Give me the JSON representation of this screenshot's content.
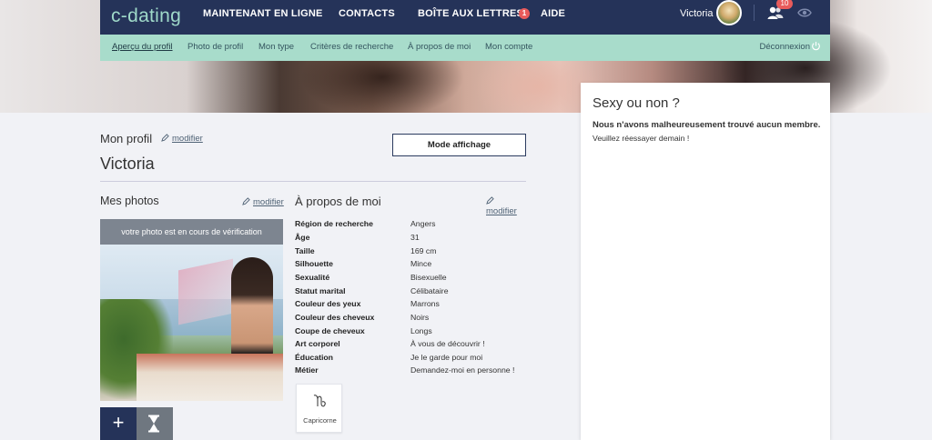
{
  "brand": {
    "logo": "c-dating"
  },
  "topnav": {
    "items": [
      {
        "label": "MAINTENANT EN LIGNE"
      },
      {
        "label": "CONTACTS"
      },
      {
        "label": "BOÎTE AUX LETTRES",
        "badge": "1"
      },
      {
        "label": "AIDE"
      }
    ],
    "user_name": "Victoria",
    "contacts_badge": "10"
  },
  "subnav": {
    "items": [
      {
        "label": "Aperçu du profil",
        "active": true
      },
      {
        "label": "Photo de profil"
      },
      {
        "label": "Mon type"
      },
      {
        "label": "Critères de recherche"
      },
      {
        "label": "À propos de moi"
      },
      {
        "label": "Mon compte"
      }
    ],
    "logout": "Déconnexion"
  },
  "profile": {
    "section_label": "Mon profil",
    "modify_label": "modifier",
    "name": "Victoria",
    "mode_button": "Mode affichage"
  },
  "photos": {
    "title": "Mes photos",
    "modify_label": "modifier",
    "verification_notice": "votre photo est en cours de vérification",
    "add_label": "+"
  },
  "about": {
    "title": "À propos de moi",
    "modify_label": "modifier",
    "attributes": [
      {
        "key": "Région de recherche",
        "value": "Angers"
      },
      {
        "key": "Âge",
        "value": "31"
      },
      {
        "key": "Taille",
        "value": "169 cm"
      },
      {
        "key": "Silhouette",
        "value": "Mince"
      },
      {
        "key": "Sexualité",
        "value": "Bisexuelle"
      },
      {
        "key": "Statut marital",
        "value": "Célibataire"
      },
      {
        "key": "Couleur des yeux",
        "value": "Marrons"
      },
      {
        "key": "Couleur des cheveux",
        "value": "Noirs"
      },
      {
        "key": "Coupe de cheveux",
        "value": "Longs"
      },
      {
        "key": "Art corporel",
        "value": "À vous de découvrir !"
      },
      {
        "key": "Éducation",
        "value": "Je le garde pour moi"
      },
      {
        "key": "Métier",
        "value": "Demandez-moi en personne !"
      }
    ],
    "zodiac": {
      "label": "Capricorne",
      "icon": "capricorn-icon"
    }
  },
  "panel": {
    "title": "Sexy ou non ?",
    "strong_text": "Nous n'avons malheureusement trouvé aucun membre.",
    "text": "Veuillez réessayer demain !"
  },
  "colors": {
    "nav_bg": "#253359",
    "subnav_bg": "#a8dccb",
    "badge": "#e85b5b",
    "logo": "#9fd9c9"
  }
}
